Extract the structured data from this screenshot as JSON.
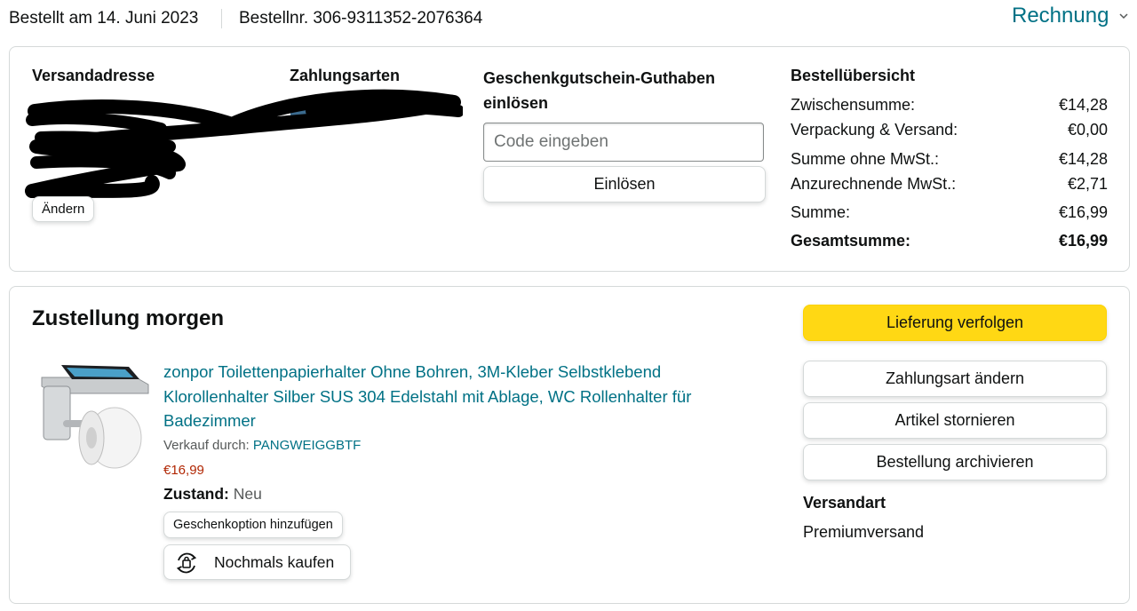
{
  "header": {
    "order_date": "Bestellt am 14. Juni 2023",
    "order_number": "Bestellnr. 306-9311352-2076364",
    "invoice_label": "Rechnung",
    "invoice_icon": "chevron-down-icon"
  },
  "shipping_address": {
    "title": "Versandadresse",
    "change_label": "Ändern"
  },
  "payment": {
    "title": "Zahlungsarten"
  },
  "gift_card": {
    "title": "Geschenkgutschein-Guthaben einlösen",
    "input_placeholder": "Code eingeben",
    "input_value": "",
    "redeem_label": "Einlösen"
  },
  "summary": {
    "title": "Bestellübersicht",
    "rows": [
      {
        "label": "Zwischensumme:",
        "value": "€14,28"
      },
      {
        "label": "Verpackung & Versand:",
        "value": "€0,00"
      },
      {
        "label": "Summe ohne MwSt.:",
        "value": "€14,28"
      },
      {
        "label": "Anzurechnende MwSt.:",
        "value": "€2,71"
      },
      {
        "label": "Summe:",
        "value": "€16,99"
      },
      {
        "label": "Gesamtsumme:",
        "value": "€16,99"
      }
    ]
  },
  "delivery": {
    "title": "Zustellung morgen",
    "product": {
      "title": "zonpor Toilettenpapierhalter Ohne Bohren, 3M-Kleber Selbstklebend Klorollenhalter Silber SUS 304 Edelstahl mit Ablage, WC Rollenhalter für Badezimmer",
      "seller_label": "Verkauf durch:",
      "seller_name": "PANGWEIGGBTF",
      "price": "€16,99",
      "condition_label": "Zustand:",
      "condition_value": "Neu",
      "gift_option_label": "Geschenkoption hinzufügen",
      "rebuy_label": "Nochmals kaufen"
    },
    "actions": {
      "track": "Lieferung verfolgen",
      "change_payment": "Zahlungsart ändern",
      "cancel": "Artikel stornieren",
      "archive": "Bestellung archivieren"
    },
    "shipping_method_title": "Versandart",
    "shipping_method_value": "Premiumversand"
  },
  "colors": {
    "link": "#007185",
    "price": "#b12704",
    "primary_button": "#ffd814",
    "border": "#d5d9d9"
  }
}
